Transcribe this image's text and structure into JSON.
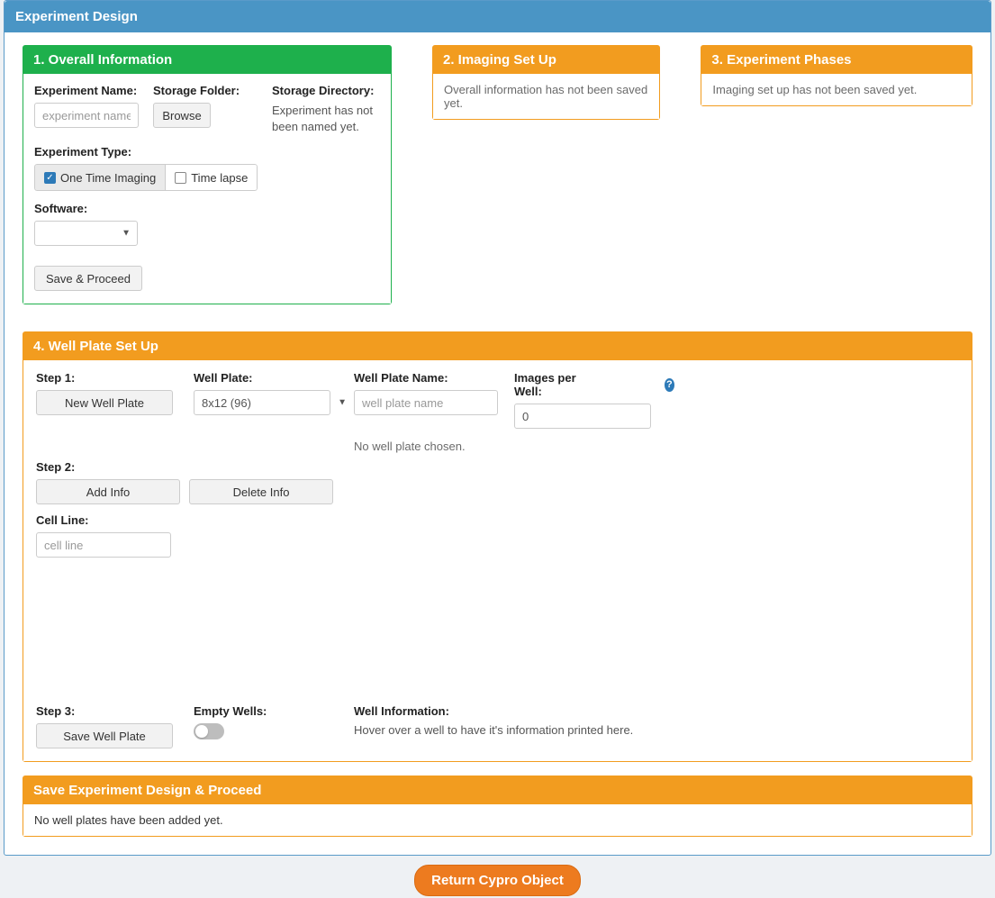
{
  "page": {
    "title": "Experiment Design"
  },
  "overall": {
    "title": "1. Overall Information",
    "name_label": "Experiment Name:",
    "name_placeholder": "experiment name",
    "folder_label": "Storage Folder:",
    "browse_label": "Browse",
    "dir_label": "Storage Directory:",
    "dir_status": "Experiment has not been named yet.",
    "type_label": "Experiment Type:",
    "type_onetime": "One Time Imaging",
    "type_timelapse": "Time lapse",
    "software_label": "Software:",
    "save_label": "Save & Proceed"
  },
  "imaging": {
    "title": "2. Imaging Set Up",
    "status": "Overall information has not been saved yet."
  },
  "phases": {
    "title": "3. Experiment Phases",
    "status": "Imaging set up has not been saved yet."
  },
  "wellplate": {
    "title": "4. Well Plate Set Up",
    "step1_label": "Step 1:",
    "new_btn": "New Well Plate",
    "wp_label": "Well Plate:",
    "wp_selected": "8x12 (96)",
    "wp_name_label": "Well Plate Name:",
    "wp_name_placeholder": "well plate name",
    "ipw_label": "Images per Well:",
    "ipw_value": "0",
    "no_wp_text": "No well plate chosen.",
    "step2_label": "Step 2:",
    "add_info": "Add Info",
    "delete_info": "Delete Info",
    "cell_line_label": "Cell Line:",
    "cell_line_placeholder": "cell line",
    "step3_label": "Step 3:",
    "save_wp": "Save Well Plate",
    "empty_wells_label": "Empty Wells:",
    "well_info_label": "Well Information:",
    "well_info_text": "Hover over a well to have it's information printed here."
  },
  "saveexp": {
    "title": "Save Experiment Design & Proceed",
    "status": "No well plates have been added yet."
  },
  "footer": {
    "return_label": "Return Cypro Object"
  }
}
